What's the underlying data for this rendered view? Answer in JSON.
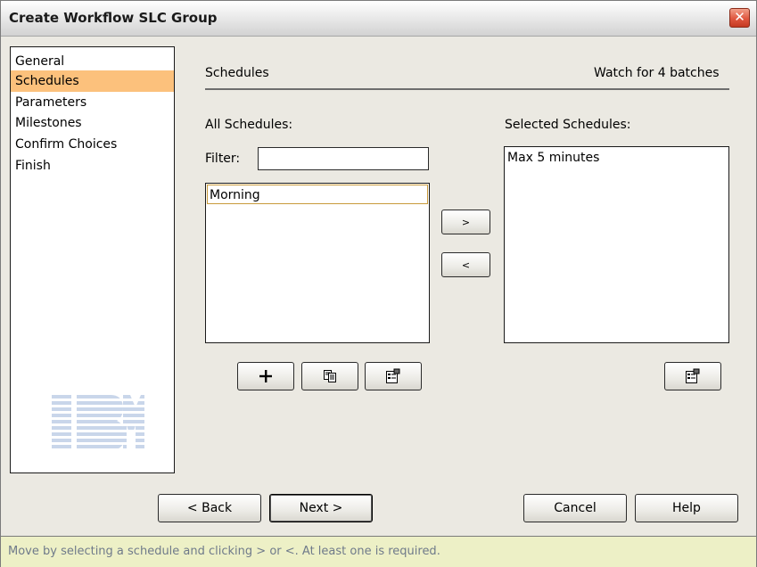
{
  "window": {
    "title": "Create Workflow SLC Group",
    "close_glyph": "✕"
  },
  "nav": {
    "items": [
      {
        "label": "General",
        "selected": false
      },
      {
        "label": "Schedules",
        "selected": true
      },
      {
        "label": "Parameters",
        "selected": false
      },
      {
        "label": "Milestones",
        "selected": false
      },
      {
        "label": "Confirm Choices",
        "selected": false
      },
      {
        "label": "Finish",
        "selected": false
      }
    ],
    "logo": "IBM",
    "selected_color": "#fcc17c"
  },
  "header": {
    "section_title": "Schedules",
    "status": "Watch for 4 batches"
  },
  "all_schedules": {
    "label": "All Schedules:",
    "filter_label": "Filter:",
    "filter_value": "",
    "items": [
      "Morning"
    ]
  },
  "selected_schedules": {
    "label": "Selected Schedules:",
    "items": [
      "Max 5 minutes"
    ]
  },
  "transfer": {
    "add_label": ">",
    "remove_label": "<"
  },
  "list_tools": {
    "new_icon": "plus-icon",
    "copy_icon": "copy-icon",
    "properties_icon": "properties-icon"
  },
  "footer": {
    "back_label": "< Back",
    "next_label": "Next >",
    "cancel_label": "Cancel",
    "help_label": "Help"
  },
  "status_message": "Move by selecting a schedule and clicking > or <. At least one is required."
}
